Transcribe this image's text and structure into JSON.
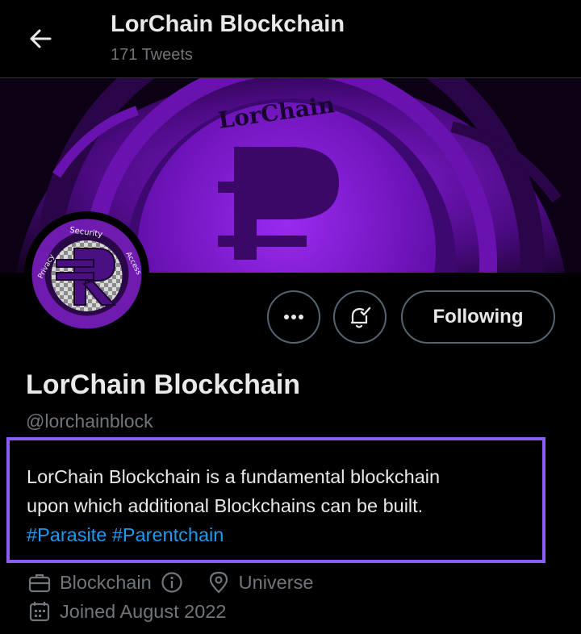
{
  "header": {
    "title": "LorChain Blockchain",
    "subtitle": "171 Tweets"
  },
  "banner": {
    "text": "LorChain"
  },
  "avatar": {
    "ring_text_top": "Security",
    "ring_text_left": "Privacy",
    "ring_text_right": "Access"
  },
  "actions": {
    "follow_label": "Following"
  },
  "profile": {
    "name": "LorChain Blockchain",
    "handle": "@lorchainblock",
    "bio_line1": "LorChain Blockchain is a fundamental blockchain",
    "bio_line2": "upon which additional Blockchains can be built.",
    "hashtags": [
      "#Parasite",
      "#Parentchain"
    ],
    "category": "Blockchain",
    "location": "Universe",
    "joined": "Joined August 2022"
  },
  "icons": {
    "back": "arrow-left-icon",
    "more": "more-horizontal-icon",
    "notify": "bell-check-icon",
    "category": "briefcase-icon",
    "info": "info-icon",
    "location": "location-pin-icon",
    "calendar": "calendar-icon"
  },
  "colors": {
    "background": "#000000",
    "accent_purple": "#8b5cf6",
    "hashtag_blue": "#1d9bf0",
    "muted_text": "#71767b",
    "banner_purple": "#7a10c8"
  }
}
